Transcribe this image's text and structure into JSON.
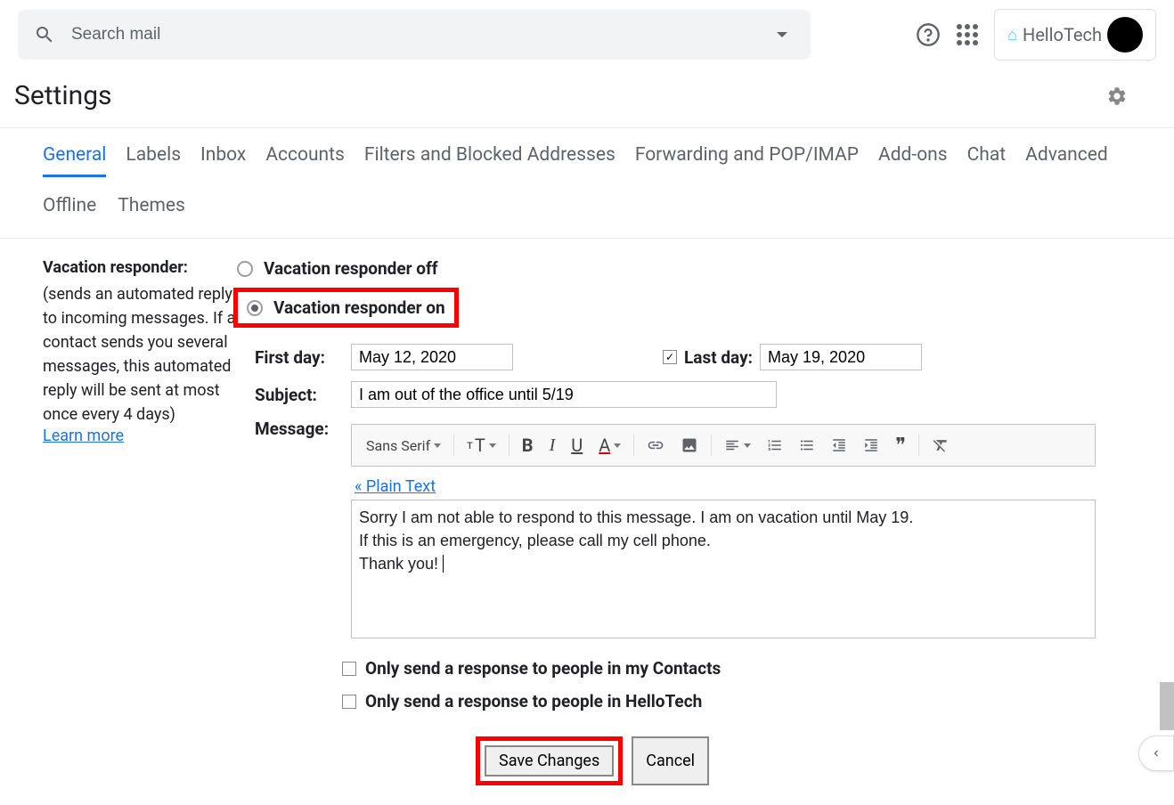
{
  "search": {
    "placeholder": "Search mail"
  },
  "brand": {
    "text": "HelloTech"
  },
  "page_title": "Settings",
  "tabs": [
    "General",
    "Labels",
    "Inbox",
    "Accounts",
    "Filters and Blocked Addresses",
    "Forwarding and POP/IMAP",
    "Add-ons",
    "Chat",
    "Advanced"
  ],
  "tabs2": [
    "Offline",
    "Themes"
  ],
  "vacation": {
    "section_title": "Vacation responder:",
    "desc": "(sends an automated reply to incoming messages. If a contact sends you several messages, this automated reply will be sent at most once every 4 days)",
    "learn_more": "Learn more",
    "off_label": "Vacation responder off",
    "on_label": "Vacation responder on",
    "first_day_label": "First day:",
    "first_day_value": "May 12, 2020",
    "last_day_label": "Last day:",
    "last_day_value": "May 19, 2020",
    "subject_label": "Subject:",
    "subject_value": "I am out of the office until 5/19",
    "message_label": "Message:",
    "font_label": "Sans Serif",
    "plain_text_label": "« Plain Text",
    "message_body_line1": "Sorry I am not able to respond to this message. I am on vacation until May 19.",
    "message_body_line2": "If this is an emergency, please call my cell phone.",
    "message_body_line3": "Thank you!",
    "only_contacts_label": "Only send a response to people in my Contacts",
    "only_domain_label": "Only send a response to people in HelloTech"
  },
  "buttons": {
    "save": "Save Changes",
    "cancel": "Cancel"
  }
}
